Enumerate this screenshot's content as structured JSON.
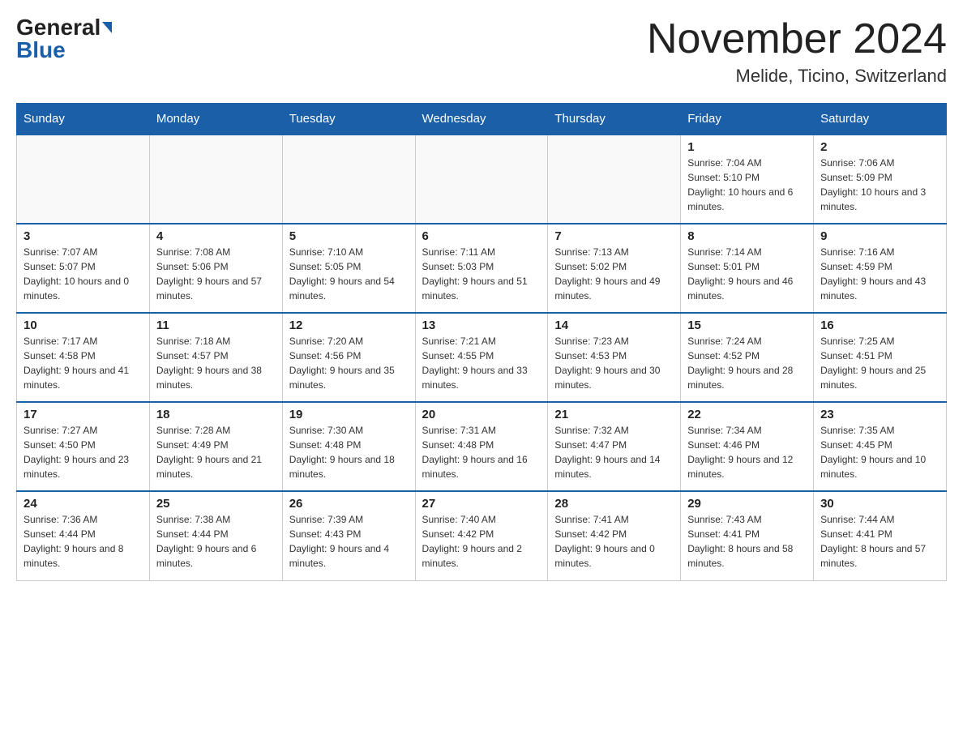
{
  "logo": {
    "general": "General",
    "blue": "Blue"
  },
  "title": "November 2024",
  "location": "Melide, Ticino, Switzerland",
  "days_of_week": [
    "Sunday",
    "Monday",
    "Tuesday",
    "Wednesday",
    "Thursday",
    "Friday",
    "Saturday"
  ],
  "weeks": [
    [
      {
        "day": "",
        "sunrise": "",
        "sunset": "",
        "daylight": ""
      },
      {
        "day": "",
        "sunrise": "",
        "sunset": "",
        "daylight": ""
      },
      {
        "day": "",
        "sunrise": "",
        "sunset": "",
        "daylight": ""
      },
      {
        "day": "",
        "sunrise": "",
        "sunset": "",
        "daylight": ""
      },
      {
        "day": "",
        "sunrise": "",
        "sunset": "",
        "daylight": ""
      },
      {
        "day": "1",
        "sunrise": "Sunrise: 7:04 AM",
        "sunset": "Sunset: 5:10 PM",
        "daylight": "Daylight: 10 hours and 6 minutes."
      },
      {
        "day": "2",
        "sunrise": "Sunrise: 7:06 AM",
        "sunset": "Sunset: 5:09 PM",
        "daylight": "Daylight: 10 hours and 3 minutes."
      }
    ],
    [
      {
        "day": "3",
        "sunrise": "Sunrise: 7:07 AM",
        "sunset": "Sunset: 5:07 PM",
        "daylight": "Daylight: 10 hours and 0 minutes."
      },
      {
        "day": "4",
        "sunrise": "Sunrise: 7:08 AM",
        "sunset": "Sunset: 5:06 PM",
        "daylight": "Daylight: 9 hours and 57 minutes."
      },
      {
        "day": "5",
        "sunrise": "Sunrise: 7:10 AM",
        "sunset": "Sunset: 5:05 PM",
        "daylight": "Daylight: 9 hours and 54 minutes."
      },
      {
        "day": "6",
        "sunrise": "Sunrise: 7:11 AM",
        "sunset": "Sunset: 5:03 PM",
        "daylight": "Daylight: 9 hours and 51 minutes."
      },
      {
        "day": "7",
        "sunrise": "Sunrise: 7:13 AM",
        "sunset": "Sunset: 5:02 PM",
        "daylight": "Daylight: 9 hours and 49 minutes."
      },
      {
        "day": "8",
        "sunrise": "Sunrise: 7:14 AM",
        "sunset": "Sunset: 5:01 PM",
        "daylight": "Daylight: 9 hours and 46 minutes."
      },
      {
        "day": "9",
        "sunrise": "Sunrise: 7:16 AM",
        "sunset": "Sunset: 4:59 PM",
        "daylight": "Daylight: 9 hours and 43 minutes."
      }
    ],
    [
      {
        "day": "10",
        "sunrise": "Sunrise: 7:17 AM",
        "sunset": "Sunset: 4:58 PM",
        "daylight": "Daylight: 9 hours and 41 minutes."
      },
      {
        "day": "11",
        "sunrise": "Sunrise: 7:18 AM",
        "sunset": "Sunset: 4:57 PM",
        "daylight": "Daylight: 9 hours and 38 minutes."
      },
      {
        "day": "12",
        "sunrise": "Sunrise: 7:20 AM",
        "sunset": "Sunset: 4:56 PM",
        "daylight": "Daylight: 9 hours and 35 minutes."
      },
      {
        "day": "13",
        "sunrise": "Sunrise: 7:21 AM",
        "sunset": "Sunset: 4:55 PM",
        "daylight": "Daylight: 9 hours and 33 minutes."
      },
      {
        "day": "14",
        "sunrise": "Sunrise: 7:23 AM",
        "sunset": "Sunset: 4:53 PM",
        "daylight": "Daylight: 9 hours and 30 minutes."
      },
      {
        "day": "15",
        "sunrise": "Sunrise: 7:24 AM",
        "sunset": "Sunset: 4:52 PM",
        "daylight": "Daylight: 9 hours and 28 minutes."
      },
      {
        "day": "16",
        "sunrise": "Sunrise: 7:25 AM",
        "sunset": "Sunset: 4:51 PM",
        "daylight": "Daylight: 9 hours and 25 minutes."
      }
    ],
    [
      {
        "day": "17",
        "sunrise": "Sunrise: 7:27 AM",
        "sunset": "Sunset: 4:50 PM",
        "daylight": "Daylight: 9 hours and 23 minutes."
      },
      {
        "day": "18",
        "sunrise": "Sunrise: 7:28 AM",
        "sunset": "Sunset: 4:49 PM",
        "daylight": "Daylight: 9 hours and 21 minutes."
      },
      {
        "day": "19",
        "sunrise": "Sunrise: 7:30 AM",
        "sunset": "Sunset: 4:48 PM",
        "daylight": "Daylight: 9 hours and 18 minutes."
      },
      {
        "day": "20",
        "sunrise": "Sunrise: 7:31 AM",
        "sunset": "Sunset: 4:48 PM",
        "daylight": "Daylight: 9 hours and 16 minutes."
      },
      {
        "day": "21",
        "sunrise": "Sunrise: 7:32 AM",
        "sunset": "Sunset: 4:47 PM",
        "daylight": "Daylight: 9 hours and 14 minutes."
      },
      {
        "day": "22",
        "sunrise": "Sunrise: 7:34 AM",
        "sunset": "Sunset: 4:46 PM",
        "daylight": "Daylight: 9 hours and 12 minutes."
      },
      {
        "day": "23",
        "sunrise": "Sunrise: 7:35 AM",
        "sunset": "Sunset: 4:45 PM",
        "daylight": "Daylight: 9 hours and 10 minutes."
      }
    ],
    [
      {
        "day": "24",
        "sunrise": "Sunrise: 7:36 AM",
        "sunset": "Sunset: 4:44 PM",
        "daylight": "Daylight: 9 hours and 8 minutes."
      },
      {
        "day": "25",
        "sunrise": "Sunrise: 7:38 AM",
        "sunset": "Sunset: 4:44 PM",
        "daylight": "Daylight: 9 hours and 6 minutes."
      },
      {
        "day": "26",
        "sunrise": "Sunrise: 7:39 AM",
        "sunset": "Sunset: 4:43 PM",
        "daylight": "Daylight: 9 hours and 4 minutes."
      },
      {
        "day": "27",
        "sunrise": "Sunrise: 7:40 AM",
        "sunset": "Sunset: 4:42 PM",
        "daylight": "Daylight: 9 hours and 2 minutes."
      },
      {
        "day": "28",
        "sunrise": "Sunrise: 7:41 AM",
        "sunset": "Sunset: 4:42 PM",
        "daylight": "Daylight: 9 hours and 0 minutes."
      },
      {
        "day": "29",
        "sunrise": "Sunrise: 7:43 AM",
        "sunset": "Sunset: 4:41 PM",
        "daylight": "Daylight: 8 hours and 58 minutes."
      },
      {
        "day": "30",
        "sunrise": "Sunrise: 7:44 AM",
        "sunset": "Sunset: 4:41 PM",
        "daylight": "Daylight: 8 hours and 57 minutes."
      }
    ]
  ]
}
